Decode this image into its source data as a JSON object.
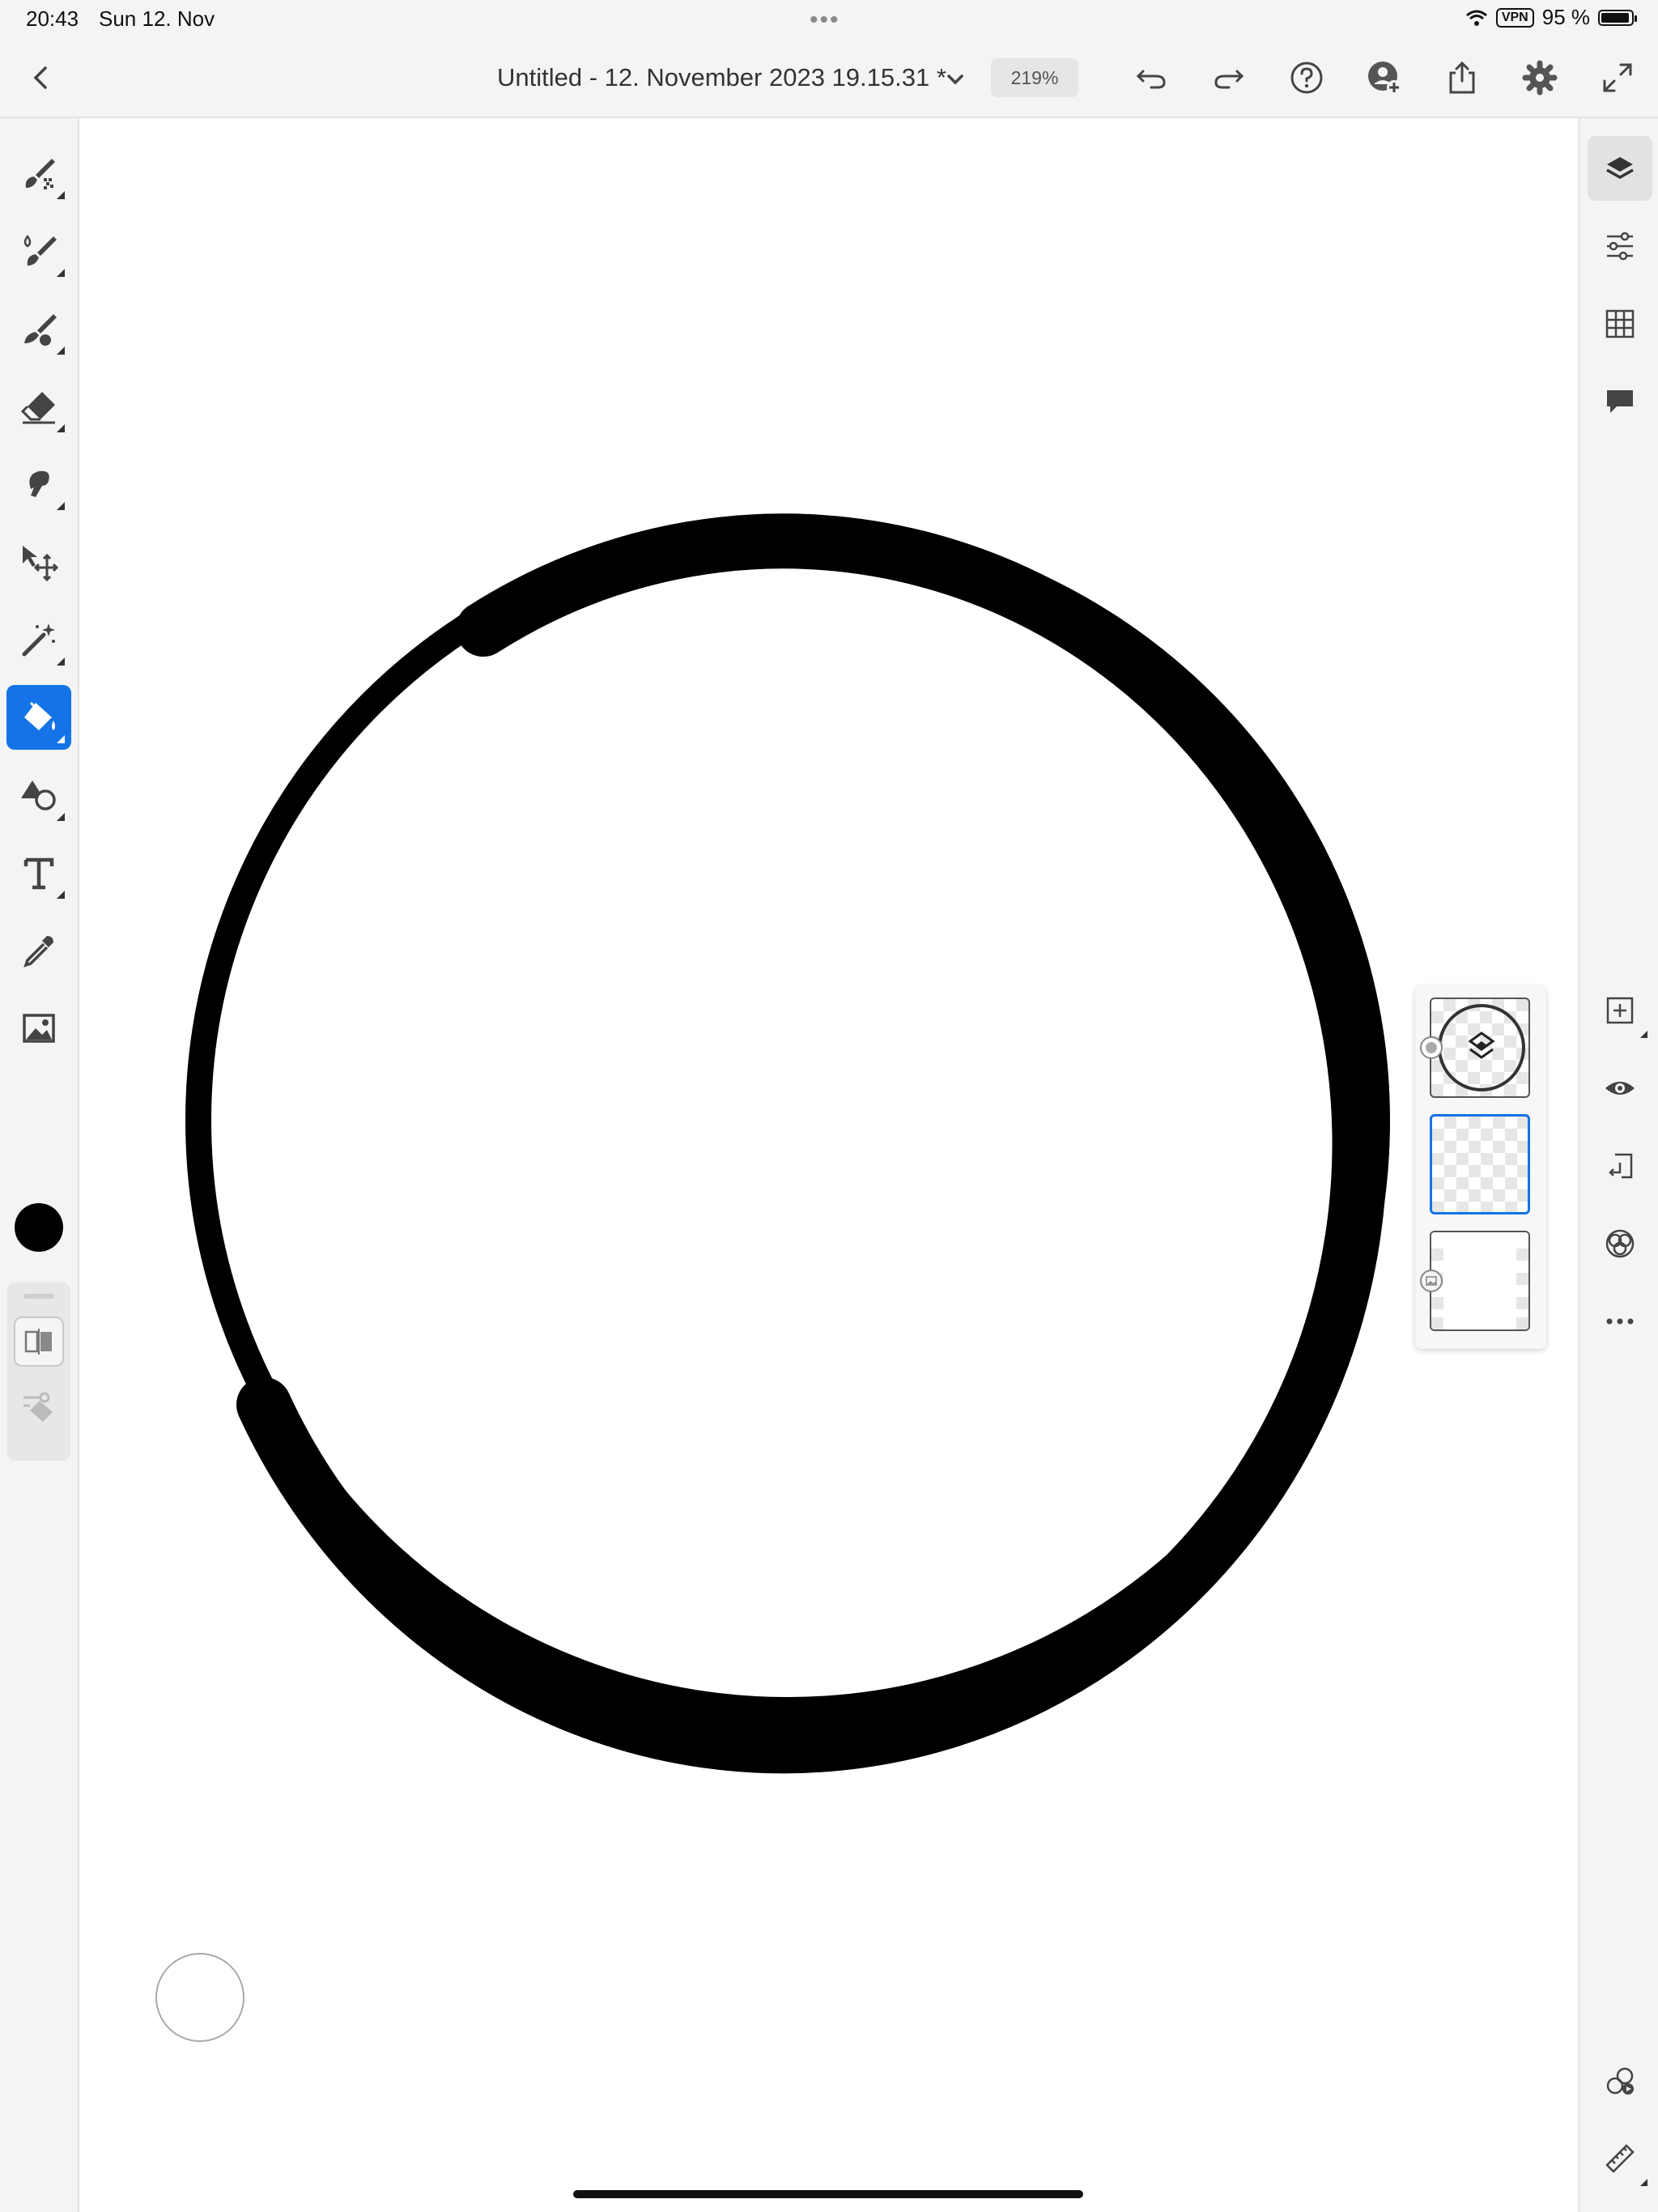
{
  "status_bar": {
    "time": "20:43",
    "date": "Sun 12. Nov",
    "vpn": "VPN",
    "battery": "95 %",
    "battery_level_percent": 95
  },
  "top_bar": {
    "document_title": "Untitled - 12. November 2023 19.15.31 *",
    "zoom": "219%"
  },
  "colors": {
    "accent": "#1473e6",
    "current_color": "#000000",
    "canvas": "#ffffff"
  },
  "left_tools": [
    {
      "name": "pixel-brush-tool",
      "icon": "pixel-brush-icon"
    },
    {
      "name": "live-brush-tool",
      "icon": "live-brush-icon"
    },
    {
      "name": "vector-brush-tool",
      "icon": "vector-brush-icon"
    },
    {
      "name": "eraser-tool",
      "icon": "eraser-icon"
    },
    {
      "name": "smudge-tool",
      "icon": "smudge-icon"
    },
    {
      "name": "transform-tool",
      "icon": "move-icon"
    },
    {
      "name": "selection-tool",
      "icon": "magic-wand-icon"
    },
    {
      "name": "fill-tool",
      "icon": "paint-bucket-icon",
      "active": true
    },
    {
      "name": "shapes-tool",
      "icon": "shapes-icon"
    },
    {
      "name": "text-tool",
      "icon": "text-icon"
    },
    {
      "name": "eyedropper-tool",
      "icon": "eyedropper-icon"
    },
    {
      "name": "image-tool",
      "icon": "image-icon"
    }
  ],
  "right_tools": [
    {
      "name": "layers-button",
      "icon": "layers-icon",
      "active": true
    },
    {
      "name": "layer-properties-button",
      "icon": "sliders-icon"
    },
    {
      "name": "grid-button",
      "icon": "grid-icon"
    },
    {
      "name": "comments-button",
      "icon": "comment-icon"
    },
    {
      "name": "add-layer-button",
      "icon": "plus-square-icon"
    },
    {
      "name": "visibility-button",
      "icon": "eye-icon"
    },
    {
      "name": "merge-down-button",
      "icon": "merge-down-icon"
    },
    {
      "name": "blend-mode-button",
      "icon": "blend-icon"
    },
    {
      "name": "more-options-button",
      "icon": "more-icon"
    },
    {
      "name": "livestream-button",
      "icon": "livestream-icon"
    },
    {
      "name": "ruler-button",
      "icon": "ruler-icon"
    }
  ],
  "layers": [
    {
      "name": "group-layer",
      "icon": "layers-icon"
    },
    {
      "name": "drawing-layer",
      "selected": true
    },
    {
      "name": "background-layer",
      "icon": "image-icon"
    }
  ]
}
